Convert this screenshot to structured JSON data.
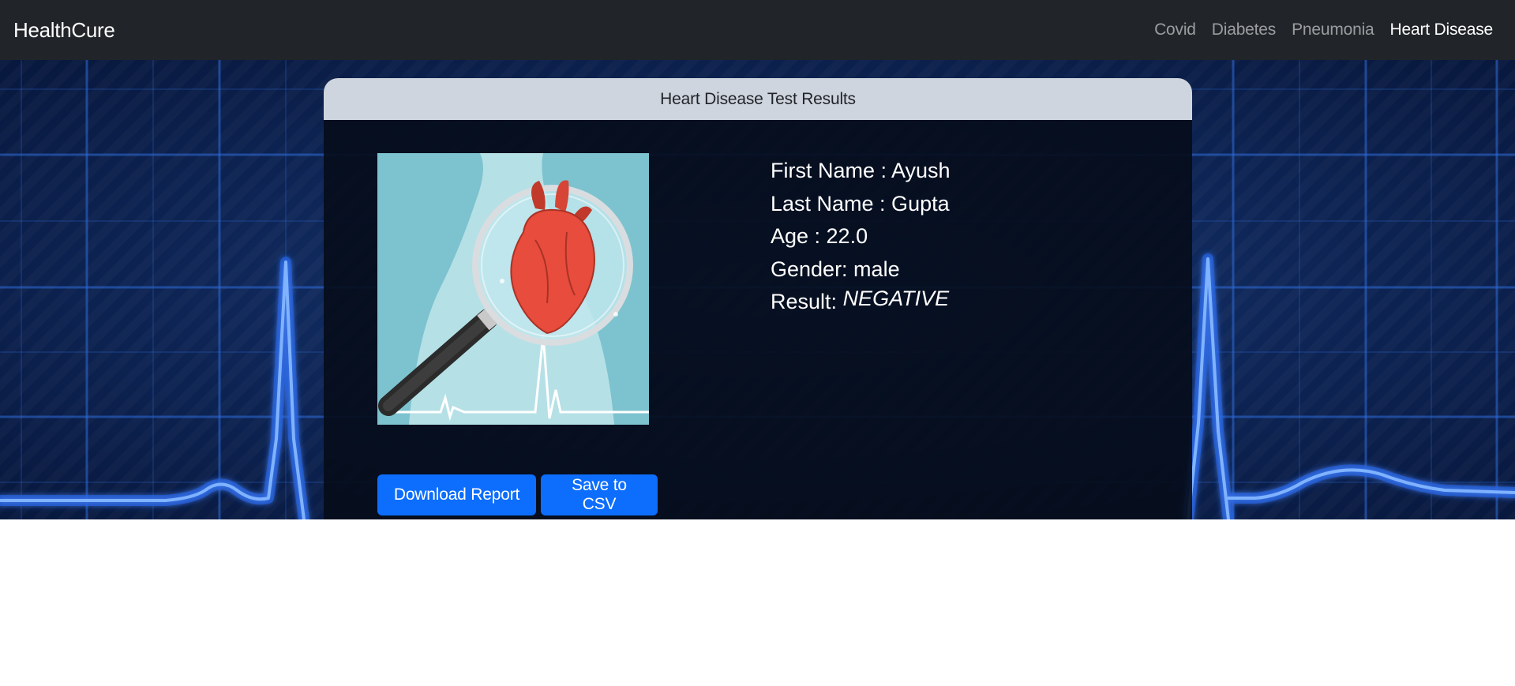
{
  "navbar": {
    "brand": "HealthCure",
    "links": [
      {
        "label": "Covid"
      },
      {
        "label": "Diabetes"
      },
      {
        "label": "Pneumonia"
      },
      {
        "label": "Heart Disease"
      }
    ]
  },
  "card": {
    "title": "Heart Disease Test Results",
    "patient": {
      "first_name": "First Name : Ayush",
      "last_name": "Last Name : Gupta",
      "age": "Age : 22.0",
      "gender": "Gender: male",
      "result_label": "Result:",
      "result_value": "NEGATIVE"
    },
    "buttons": {
      "download": "Download Report",
      "csv": "Save to CSV"
    },
    "illustration_icon": "heart-magnifier-illustration"
  },
  "colors": {
    "navbar": "#212529",
    "primary_button": "#0d6efd",
    "card_header": "#cfd5de",
    "hero_background": "#0d2454",
    "ecg_line": "#2f7bff"
  }
}
